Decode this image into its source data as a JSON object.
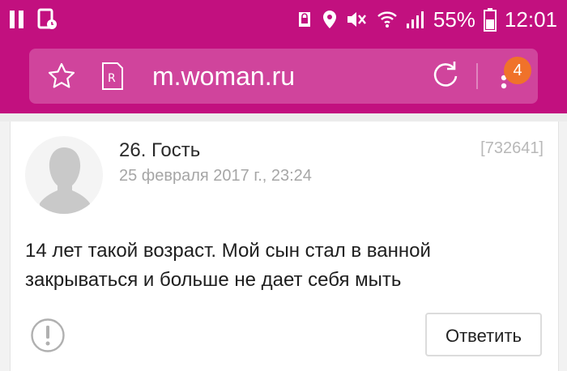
{
  "status_bar": {
    "battery_percent": "55%",
    "clock": "12:01",
    "icons": [
      "pause-icon",
      "app-notification-icon",
      "lock-notification-icon",
      "location-icon",
      "mute-icon",
      "wifi-icon",
      "signal-icon",
      "battery-icon"
    ]
  },
  "browser": {
    "url": "m.woman.ru",
    "tab_count": "4",
    "accent_color": "#c2107f",
    "badge_color": "#f0722a",
    "icons": [
      "star-icon",
      "reader-mode-icon",
      "reload-icon",
      "menu-icon"
    ]
  },
  "comment": {
    "author": "26. Гость",
    "date": "25 февраля 2017 г., 23:24",
    "id": "[732641]",
    "text_line1": "14 лет такой возраст. Мой сын стал в ванной",
    "text_line2": "закрываться и больше не дает себя мыть",
    "reply_label": "Ответить"
  }
}
